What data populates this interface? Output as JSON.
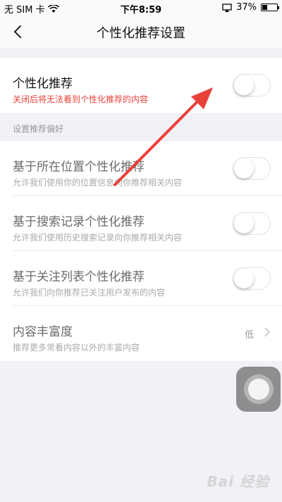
{
  "status_bar": {
    "carrier": "无 SIM 卡",
    "time": "下午8:59",
    "battery": "37%",
    "battery_level": 0.37
  },
  "nav": {
    "title": "个性化推荐设置"
  },
  "main_toggle": {
    "title": "个性化推荐",
    "subtitle": "关闭后将无法看到个性化推荐的内容",
    "on": false
  },
  "section": {
    "header": "设置推荐偏好",
    "items": [
      {
        "title": "基于所在位置个性化推荐",
        "subtitle": "允许我们使用你的位置信息向你推荐相关内容",
        "on": false
      },
      {
        "title": "基于搜索记录个性化推荐",
        "subtitle": "允许我们使用历史搜索记录向你推荐相关内容",
        "on": false
      },
      {
        "title": "基于关注列表个性化推荐",
        "subtitle": "允许我们向你推荐已关注用户发布的内容",
        "on": false
      }
    ],
    "richness": {
      "title": "内容丰富度",
      "subtitle": "推荐更多常看内容以外的丰富内容",
      "value": "低"
    }
  },
  "colors": {
    "accent_red": "#e8413a",
    "annotation_arrow": "#e8413a"
  },
  "watermark": "Bai 经验"
}
